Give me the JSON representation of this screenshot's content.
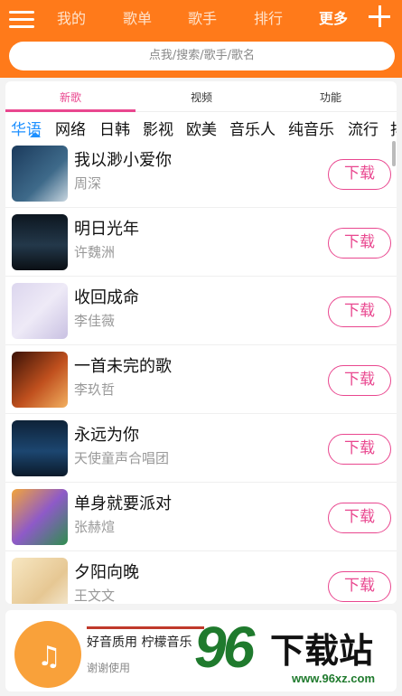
{
  "nav": {
    "items": [
      "我的",
      "歌单",
      "歌手",
      "排行",
      "更多"
    ],
    "active": "更多"
  },
  "search": {
    "placeholder": "点我/搜索/歌手/歌名"
  },
  "tabs": [
    {
      "label": "新歌",
      "active": true
    },
    {
      "label": "视频",
      "active": false
    },
    {
      "label": "功能",
      "active": false
    }
  ],
  "categories": [
    "华语",
    "网络",
    "日韩",
    "影视",
    "欧美",
    "音乐人",
    "纯音乐",
    "流行",
    "抖"
  ],
  "active_category": "华语",
  "songs": [
    {
      "title": "我以渺小爱你",
      "artist": "周深",
      "action": "下载"
    },
    {
      "title": "明日光年",
      "artist": "许魏洲",
      "action": "下载"
    },
    {
      "title": "收回成命",
      "artist": "李佳薇",
      "action": "下载"
    },
    {
      "title": "一首未完的歌",
      "artist": "李玖哲",
      "action": "下载"
    },
    {
      "title": "永远为你",
      "artist": "天使童声合唱团",
      "action": "下载"
    },
    {
      "title": "单身就要派对",
      "artist": "张赫煊",
      "action": "下载"
    },
    {
      "title": "夕阳向晚",
      "artist": "王文文",
      "action": "下载"
    }
  ],
  "player": {
    "title": "好音质用 柠檬音乐",
    "subtitle": "谢谢使用"
  },
  "watermark": {
    "logo": "96",
    "text": "下载站",
    "url": "www.96xz.com"
  },
  "colors": {
    "header": "#ff7a1a",
    "accent": "#e9478f",
    "category_active": "#1e90ff",
    "player_disc": "#f9a13a"
  }
}
